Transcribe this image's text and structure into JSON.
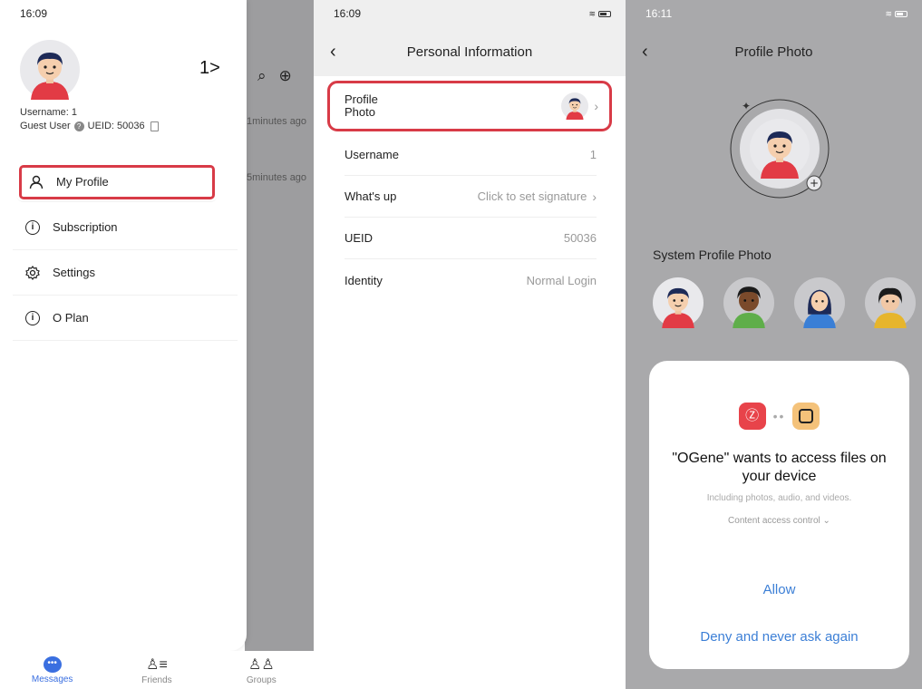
{
  "screen1": {
    "time": "16:09",
    "behind_times": [
      "1minutes ago",
      "5minutes ago"
    ],
    "profile_arrow": "1>",
    "username": "Username: 1",
    "guest": "Guest User",
    "ueid": "UEID: 50036",
    "menu": [
      {
        "label": "My Profile",
        "icon": "person-icon"
      },
      {
        "label": "Subscription",
        "icon": "info-icon"
      },
      {
        "label": "Settings",
        "icon": "gear-icon"
      },
      {
        "label": "O Plan",
        "icon": "info-icon"
      }
    ],
    "tabs": [
      {
        "label": "Messages",
        "icon": "chat-icon"
      },
      {
        "label": "Friends",
        "icon": "friends-icon"
      },
      {
        "label": "Groups",
        "icon": "groups-icon"
      }
    ]
  },
  "screen2": {
    "time": "16:09",
    "title": "Personal Information",
    "rows": {
      "photo": "Profile Photo",
      "username_label": "Username",
      "username_value": "1",
      "whatsup_label": "What's up",
      "whatsup_value": "Click to set signature",
      "ueid_label": "UEID",
      "ueid_value": "50036",
      "identity_label": "Identity",
      "identity_value": "Normal Login"
    }
  },
  "screen3": {
    "time": "16:11",
    "title": "Profile Photo",
    "system_title": "System Profile Photo",
    "dialog": {
      "title": "\"OGene\" wants to access files on your device",
      "subtitle": "Including photos, audio, and videos.",
      "control": "Content access control",
      "allow": "Allow",
      "deny": "Deny and never ask again"
    }
  },
  "colors": {
    "highlight": "#d83b47",
    "accent": "#3a6fe0",
    "dialog_link": "#3c7fd6"
  }
}
